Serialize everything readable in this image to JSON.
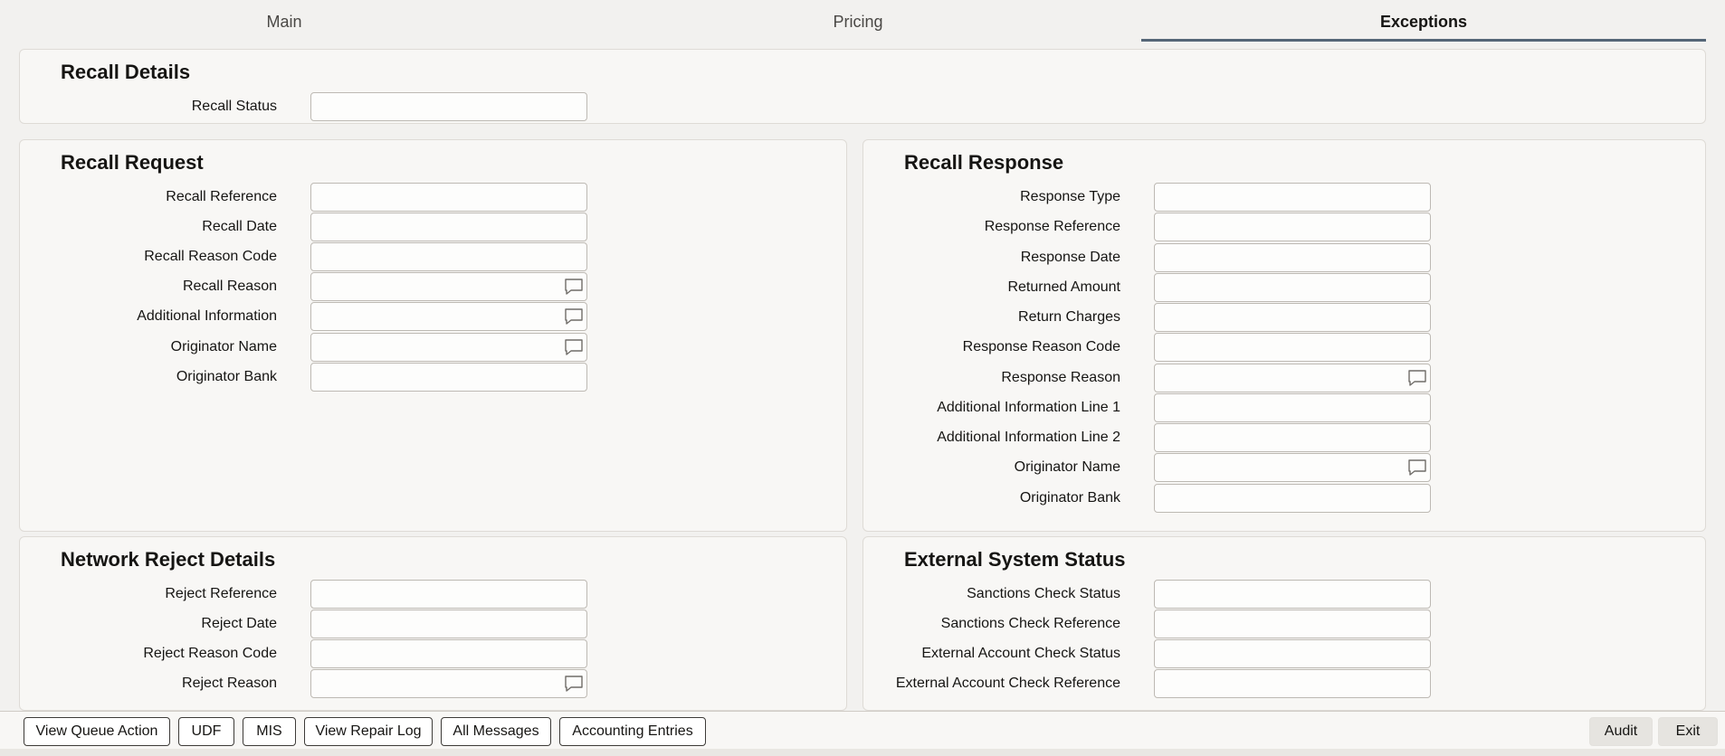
{
  "tabs": [
    {
      "label": "Main"
    },
    {
      "label": "Pricing"
    },
    {
      "label": "Exceptions",
      "active": true
    }
  ],
  "recall_details": {
    "title": "Recall Details",
    "fields": [
      {
        "label": "Recall Status",
        "value": ""
      }
    ]
  },
  "recall_request": {
    "title": "Recall Request",
    "fields": [
      {
        "label": "Recall Reference",
        "value": ""
      },
      {
        "label": "Recall Date",
        "value": ""
      },
      {
        "label": "Recall Reason Code",
        "value": ""
      },
      {
        "label": "Recall Reason",
        "value": "",
        "icon": "chat-bubble-icon"
      },
      {
        "label": "Additional Information",
        "value": "",
        "icon": "chat-bubble-icon"
      },
      {
        "label": "Originator Name",
        "value": "",
        "icon": "chat-bubble-icon"
      },
      {
        "label": "Originator Bank",
        "value": ""
      }
    ]
  },
  "recall_response": {
    "title": "Recall Response",
    "fields": [
      {
        "label": "Response Type",
        "value": ""
      },
      {
        "label": "Response Reference",
        "value": ""
      },
      {
        "label": "Response Date",
        "value": ""
      },
      {
        "label": "Returned Amount",
        "value": ""
      },
      {
        "label": "Return Charges",
        "value": ""
      },
      {
        "label": "Response Reason Code",
        "value": ""
      },
      {
        "label": "Response Reason",
        "value": "",
        "icon": "chat-bubble-icon"
      },
      {
        "label": "Additional Information Line 1",
        "value": ""
      },
      {
        "label": "Additional Information Line 2",
        "value": ""
      },
      {
        "label": "Originator Name",
        "value": "",
        "icon": "chat-bubble-icon"
      },
      {
        "label": "Originator Bank",
        "value": ""
      }
    ]
  },
  "network_reject": {
    "title": "Network Reject Details",
    "fields": [
      {
        "label": "Reject Reference",
        "value": ""
      },
      {
        "label": "Reject Date",
        "value": ""
      },
      {
        "label": "Reject Reason Code",
        "value": ""
      },
      {
        "label": "Reject Reason",
        "value": "",
        "icon": "chat-bubble-icon"
      }
    ]
  },
  "external_status": {
    "title": "External System Status",
    "fields": [
      {
        "label": "Sanctions Check Status",
        "value": ""
      },
      {
        "label": "Sanctions Check Reference",
        "value": ""
      },
      {
        "label": "External Account Check Status",
        "value": ""
      },
      {
        "label": "External Account Check Reference",
        "value": ""
      }
    ]
  },
  "footer": {
    "left_buttons": [
      "View Queue Action",
      "UDF",
      "MIS",
      "View Repair Log",
      "All Messages",
      "Accounting Entries"
    ],
    "right_buttons": [
      "Audit",
      "Exit"
    ]
  },
  "colors": {
    "accent": "#556677",
    "panel_bg": "#f8f7f5",
    "page_bg": "#f2f1ef"
  }
}
